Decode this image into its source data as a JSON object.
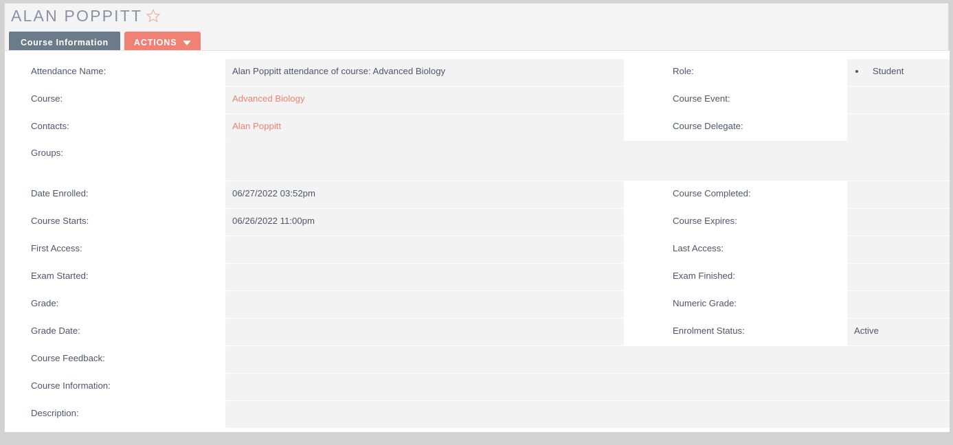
{
  "header": {
    "title": "ALAN POPPITT",
    "star_icon": "star-outline-icon",
    "tabs": [
      {
        "label": "Course Information",
        "active": true
      },
      {
        "label": "ACTIONS",
        "has_caret": true
      }
    ]
  },
  "colors": {
    "accent": "#ef8275",
    "tab_active": "#6c7b8a",
    "label_text": "#4d566b",
    "value_bg": "#f3f3f3",
    "page_bg": "#d2d2d2",
    "panel_bg": "#ffffff",
    "title_text": "#8b91a6"
  },
  "fields": {
    "attendance_name": {
      "label": "Attendance Name:",
      "value": "Alan Poppitt attendance of course: Advanced Biology"
    },
    "role": {
      "label": "Role:",
      "values": [
        "Student"
      ]
    },
    "course": {
      "label": "Course:",
      "value": "Advanced Biology",
      "is_link": true
    },
    "course_event": {
      "label": "Course Event:",
      "value": ""
    },
    "contacts": {
      "label": "Contacts:",
      "value": "Alan Poppitt",
      "is_link": true
    },
    "course_delegate": {
      "label": "Course Delegate:",
      "value": ""
    },
    "groups": {
      "label": "Groups:",
      "value": ""
    },
    "date_enrolled": {
      "label": "Date Enrolled:",
      "value": "06/27/2022 03:52pm"
    },
    "course_completed": {
      "label": "Course Completed:",
      "value": ""
    },
    "course_starts": {
      "label": "Course Starts:",
      "value": "06/26/2022 11:00pm"
    },
    "course_expires": {
      "label": "Course Expires:",
      "value": ""
    },
    "first_access": {
      "label": "First Access:",
      "value": ""
    },
    "last_access": {
      "label": "Last Access:",
      "value": ""
    },
    "exam_started": {
      "label": "Exam Started:",
      "value": ""
    },
    "exam_finished": {
      "label": "Exam Finished:",
      "value": ""
    },
    "grade": {
      "label": "Grade:",
      "value": ""
    },
    "numeric_grade": {
      "label": "Numeric Grade:",
      "value": ""
    },
    "grade_date": {
      "label": "Grade Date:",
      "value": ""
    },
    "enrolment_status": {
      "label": "Enrolment Status:",
      "value": "Active"
    },
    "course_feedback": {
      "label": "Course Feedback:",
      "value": ""
    },
    "course_information": {
      "label": "Course Information:",
      "value": ""
    },
    "description": {
      "label": "Description:",
      "value": ""
    }
  }
}
